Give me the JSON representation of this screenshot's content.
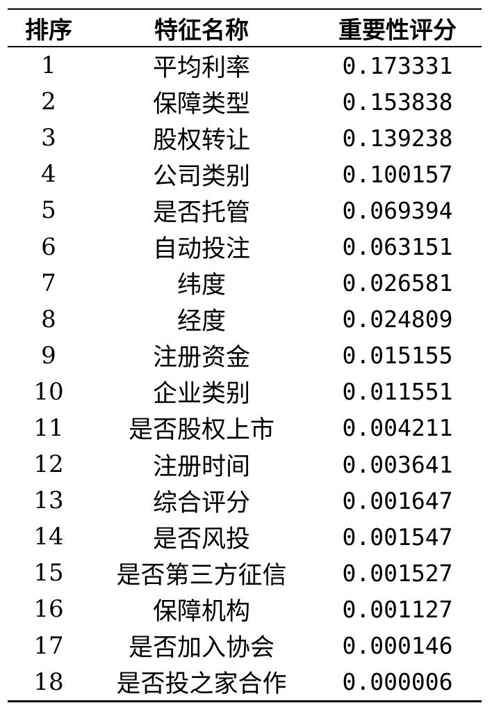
{
  "headers": {
    "rank": "排序",
    "feature": "特征名称",
    "score": "重要性评分"
  },
  "rows": [
    {
      "rank": "1",
      "feature": "平均利率",
      "score": "0.173331"
    },
    {
      "rank": "2",
      "feature": "保障类型",
      "score": "0.153838"
    },
    {
      "rank": "3",
      "feature": "股权转让",
      "score": "0.139238"
    },
    {
      "rank": "4",
      "feature": "公司类别",
      "score": "0.100157"
    },
    {
      "rank": "5",
      "feature": "是否托管",
      "score": "0.069394"
    },
    {
      "rank": "6",
      "feature": "自动投注",
      "score": "0.063151"
    },
    {
      "rank": "7",
      "feature": "纬度",
      "score": "0.026581"
    },
    {
      "rank": "8",
      "feature": "经度",
      "score": "0.024809"
    },
    {
      "rank": "9",
      "feature": "注册资金",
      "score": "0.015155"
    },
    {
      "rank": "10",
      "feature": "企业类别",
      "score": "0.011551"
    },
    {
      "rank": "11",
      "feature": "是否股权上市",
      "score": "0.004211"
    },
    {
      "rank": "12",
      "feature": "注册时间",
      "score": "0.003641"
    },
    {
      "rank": "13",
      "feature": "综合评分",
      "score": "0.001647"
    },
    {
      "rank": "14",
      "feature": "是否风投",
      "score": "0.001547"
    },
    {
      "rank": "15",
      "feature": "是否第三方征信",
      "score": "0.001527"
    },
    {
      "rank": "16",
      "feature": "保障机构",
      "score": "0.001127"
    },
    {
      "rank": "17",
      "feature": "是否加入协会",
      "score": "0.000146"
    },
    {
      "rank": "18",
      "feature": "是否投之家合作",
      "score": "0.000006"
    }
  ]
}
